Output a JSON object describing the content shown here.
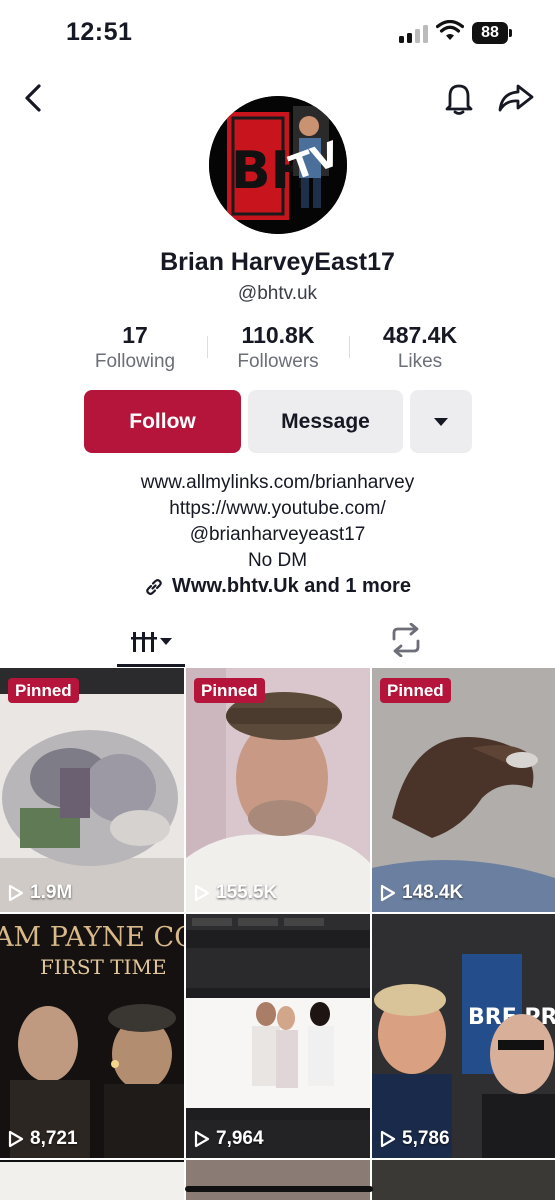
{
  "status_bar": {
    "time": "12:51",
    "battery": "88"
  },
  "nav": {
    "back_icon": "chevron-left-icon",
    "bell_icon": "bell-icon",
    "share_icon": "share-arrow-icon"
  },
  "avatar": {
    "logo_text_main": "BH",
    "logo_text_side": "TV"
  },
  "profile": {
    "display_name": "Brian HarveyEast17",
    "username": "@bhtv.uk"
  },
  "stats": [
    {
      "value": "17",
      "label": "Following"
    },
    {
      "value": "110.8K",
      "label": "Followers"
    },
    {
      "value": "487.4K",
      "label": "Likes"
    }
  ],
  "actions": {
    "follow_label": "Follow",
    "message_label": "Message"
  },
  "bio": {
    "lines": [
      "www.allmylinks.com/brianharvey",
      "https://www.youtube.com/",
      "@brianharveyeast17",
      "No DM"
    ],
    "link_text": "Www.bhtv.Uk and 1 more"
  },
  "tabs": {
    "videos_icon": "grid-bars-icon",
    "reposts_icon": "repost-icon"
  },
  "videos": [
    {
      "pinned": "Pinned",
      "views": "1.9M"
    },
    {
      "pinned": "Pinned",
      "views": "155.5K"
    },
    {
      "pinned": "Pinned",
      "views": "148.4K"
    },
    {
      "pinned": "",
      "views": "8,721",
      "overlay_line1": "AM PAYNE COVE",
      "overlay_line2": "FIRST TIME"
    },
    {
      "pinned": "",
      "views": "7,964"
    },
    {
      "pinned": "",
      "views": "5,786",
      "overlay_side": "BRE PRIZ"
    }
  ],
  "colors": {
    "brand_red": "#b5153b",
    "secondary_button": "#ededef",
    "text_primary": "#161823",
    "text_secondary": "#6c6e78"
  }
}
